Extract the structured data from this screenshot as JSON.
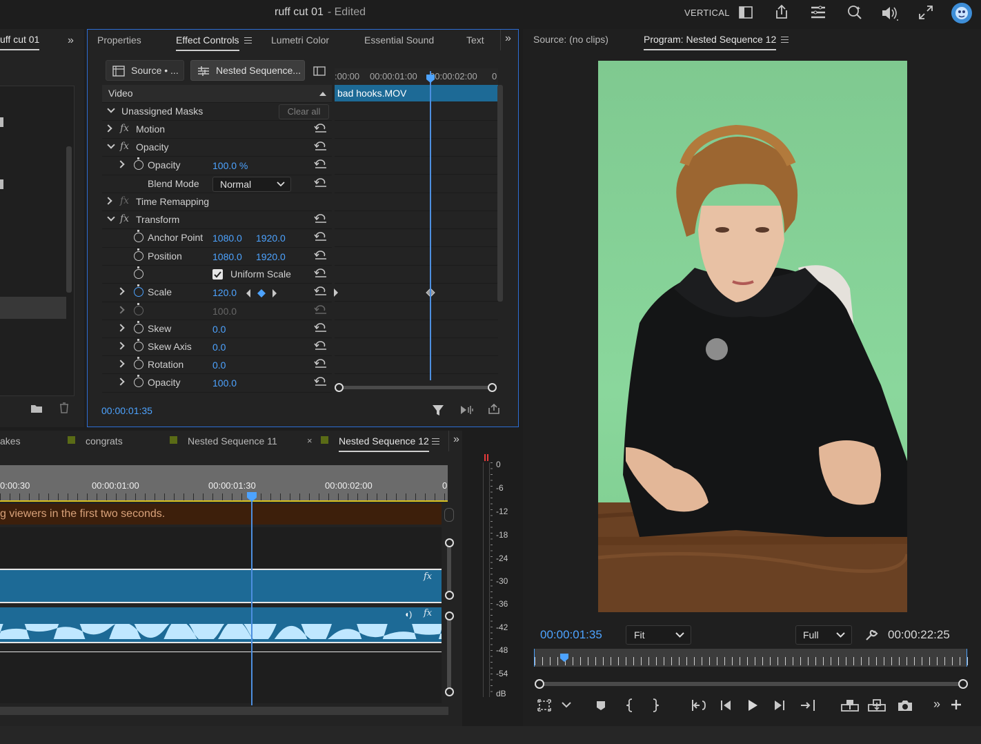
{
  "app": {
    "title": "ruff cut 01",
    "status": "- Edited",
    "workspace": "VERTICAL"
  },
  "project_panel": {
    "tab_label": "uff cut 01"
  },
  "effect_controls": {
    "tabs": [
      {
        "label": "Properties"
      },
      {
        "label": "Effect Controls"
      },
      {
        "label": "Lumetri Color"
      },
      {
        "label": "Essential Sound"
      },
      {
        "label": "Text"
      }
    ],
    "source_button": "Source • ...",
    "sequence_button": "Nested Sequence...",
    "section_video": "Video",
    "clip_name": "bad hooks.MOV",
    "timecode": "00:00:01:35",
    "ruler_labels": [
      ":00:00",
      "00:00:01:00",
      "00:00:02:00",
      "0"
    ],
    "clear_all": "Clear all",
    "rows": {
      "unassigned_masks": "Unassigned Masks",
      "motion": "Motion",
      "opacity_group": "Opacity",
      "opacity": {
        "label": "Opacity",
        "value": "100.0 %"
      },
      "blend_mode": {
        "label": "Blend Mode",
        "value": "Normal"
      },
      "time_remapping": "Time Remapping",
      "transform": "Transform",
      "anchor_point": {
        "label": "Anchor Point",
        "x": "1080.0",
        "y": "1920.0"
      },
      "position": {
        "label": "Position",
        "x": "1080.0",
        "y": "1920.0"
      },
      "uniform_scale": "Uniform Scale",
      "scale": {
        "label": "Scale",
        "value": "120.0"
      },
      "scale_width": {
        "value": "100.0"
      },
      "skew": {
        "label": "Skew",
        "value": "0.0"
      },
      "skew_axis": {
        "label": "Skew Axis",
        "value": "0.0"
      },
      "rotation": {
        "label": "Rotation",
        "value": "0.0"
      },
      "opacity2": {
        "label": "Opacity",
        "value": "100.0"
      }
    }
  },
  "timeline": {
    "tabs": [
      {
        "label": "akes"
      },
      {
        "label": "congrats"
      },
      {
        "label": "Nested Sequence 11"
      },
      {
        "label": "Nested Sequence 12"
      }
    ],
    "ruler_labels": [
      "0:00:30",
      "00:00:01:00",
      "00:00:01:30",
      "00:00:02:00",
      "0"
    ],
    "caption_text": "g viewers in the first two seconds."
  },
  "audio_meter": {
    "labels": [
      "0",
      "-6",
      "-12",
      "-18",
      "-24",
      "-30",
      "-36",
      "-42",
      "-48",
      "-54",
      "dB"
    ]
  },
  "program_monitor": {
    "source_tab": "Source: (no clips)",
    "program_tab": "Program: Nested Sequence 12",
    "current_timecode": "00:00:01:35",
    "fit_select": "Fit",
    "quality_select": "Full",
    "duration": "00:00:22:25"
  },
  "colors": {
    "accent": "#4da3ff",
    "panel_border": "#2d6ed6",
    "clip_video": "#1d6a96",
    "caption_track": "#3d1f0b",
    "chroma_green": "#84cf94"
  }
}
